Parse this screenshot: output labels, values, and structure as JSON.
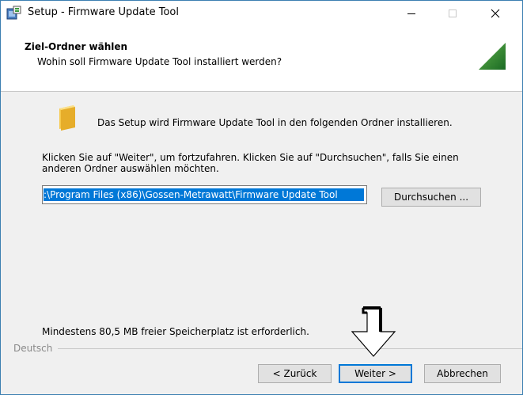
{
  "window": {
    "title": "Setup - Firmware Update Tool",
    "icons": {
      "app": "setup-installer-icon",
      "minimize": "minimize-icon",
      "maximize": "maximize-icon",
      "close": "close-icon"
    }
  },
  "header": {
    "title": "Ziel-Ordner wählen",
    "subtitle": "Wohin soll Firmware Update Tool installiert werden?",
    "logo_icon": "green-triangle-logo-icon",
    "logo_color": "#2e7d32"
  },
  "content": {
    "folder_icon": "folder-icon",
    "intro": "Das Setup wird Firmware Update Tool in den folgenden Ordner installieren.",
    "instruction": "Klicken Sie auf \"Weiter\", um fortzufahren. Klicken Sie auf \"Durchsuchen\", falls Sie einen anderen Ordner auswählen möchten.",
    "path_value": ":\\Program Files (x86)\\Gossen-Metrawatt\\Firmware Update Tool",
    "browse_label": "Durchsuchen ...",
    "space_required": "Mindestens 80,5 MB freier Speicherplatz ist erforderlich."
  },
  "footer": {
    "language": "Deutsch",
    "back_label": "< Zurück",
    "next_label": "Weiter >",
    "cancel_label": "Abbrechen"
  },
  "overlay": {
    "arrow_icon": "down-arrow-pointer-icon"
  },
  "colors": {
    "selection": "#0078d7",
    "focus_border": "#0078d7",
    "dialog_bg": "#f0f0f0"
  }
}
